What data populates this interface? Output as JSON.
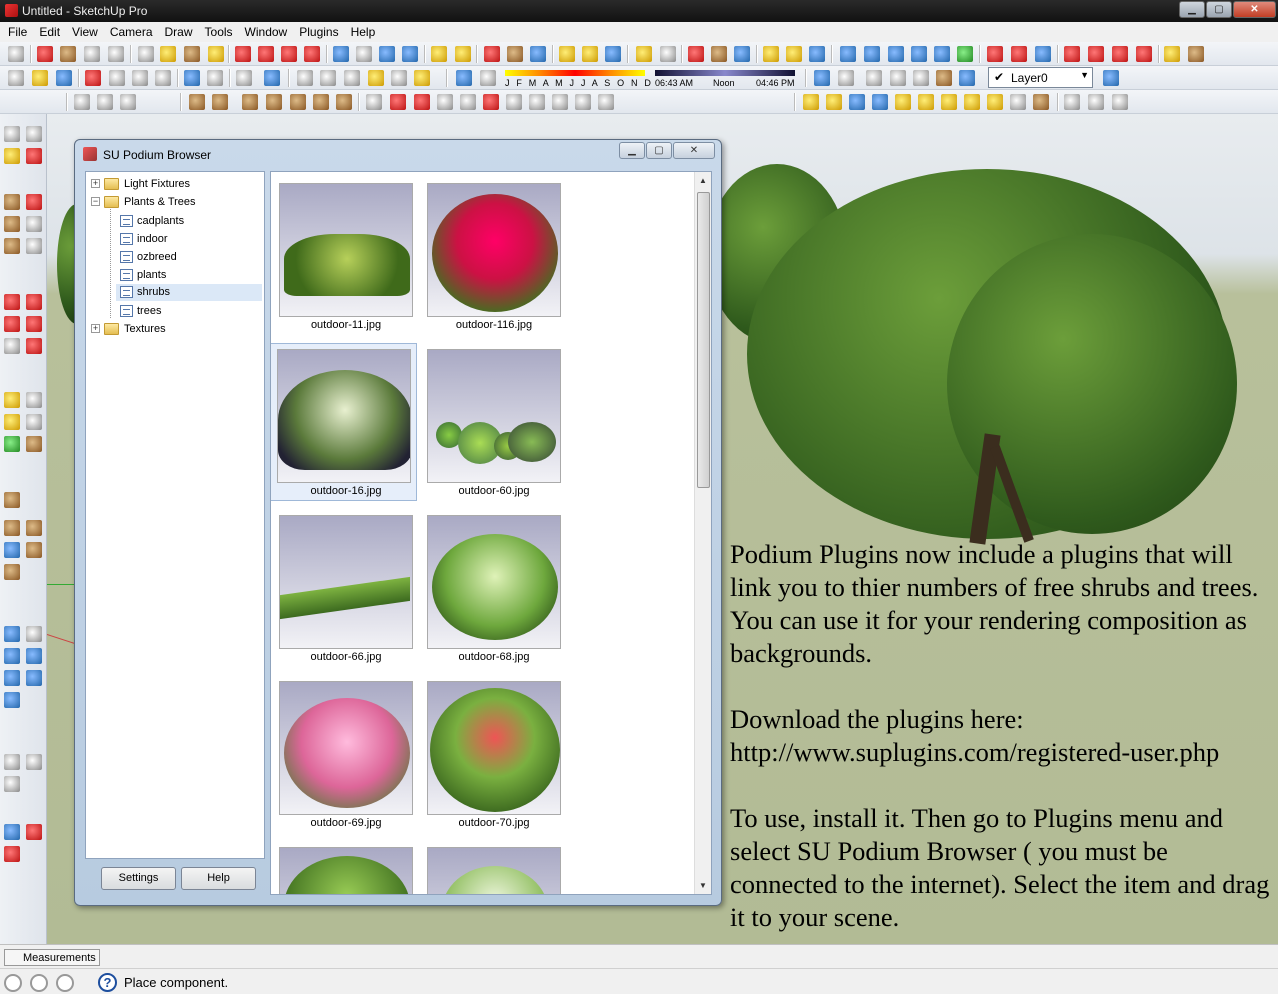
{
  "window": {
    "title": "Untitled - SketchUp Pro",
    "min": "▁",
    "max": "▢",
    "close": "✕"
  },
  "menu": [
    "File",
    "Edit",
    "View",
    "Camera",
    "Draw",
    "Tools",
    "Window",
    "Plugins",
    "Help"
  ],
  "shadow_settings": {
    "months": "J F M A M J J A S O N D",
    "time_start": "06:43 AM",
    "time_mid": "Noon",
    "time_end": "04:46 PM"
  },
  "layer": {
    "check": "✔",
    "value": "Layer0",
    "arrow": "▼"
  },
  "dialog": {
    "title": "SU Podium Browser",
    "min": "▁",
    "max": "▢",
    "close": "✕",
    "tree": [
      {
        "label": "Light Fixtures",
        "type": "folder",
        "expander": "+"
      },
      {
        "label": "Plants & Trees",
        "type": "folder",
        "expander": "−"
      },
      {
        "label": "cadplants",
        "type": "doc"
      },
      {
        "label": "indoor",
        "type": "doc"
      },
      {
        "label": "ozbreed",
        "type": "doc"
      },
      {
        "label": "plants",
        "type": "doc"
      },
      {
        "label": "shrubs",
        "type": "doc"
      },
      {
        "label": "trees",
        "type": "doc"
      },
      {
        "label": "Textures",
        "type": "folder",
        "expander": "+"
      }
    ],
    "settings_label": "Settings",
    "help_label": "Help",
    "thumbnails": [
      "outdoor-11.jpg",
      "outdoor-116.jpg",
      "outdoor-16.jpg",
      "outdoor-60.jpg",
      "outdoor-66.jpg",
      "outdoor-68.jpg",
      "outdoor-69.jpg",
      "outdoor-70.jpg"
    ],
    "scroll_up": "▲",
    "scroll_down": "▼"
  },
  "description": [
    "Podium Plugins now include a plugins that will link you to thier numbers of free shrubs and trees. You can use it for your rendering composition as backgrounds.",
    "Download the plugins here: http://www.suplugins.com/registered-user.php",
    "To use, install it. Then go to Plugins menu and select SU Podium Browser ( you must be connected to the internet). Select the item and drag it to your scene."
  ],
  "measurements_label": "Measurements",
  "status": {
    "help_glyph": "?",
    "text": "Place component."
  },
  "colors": {
    "accent": "#1d4e9e",
    "viewport_ground": "#b2bb95"
  }
}
